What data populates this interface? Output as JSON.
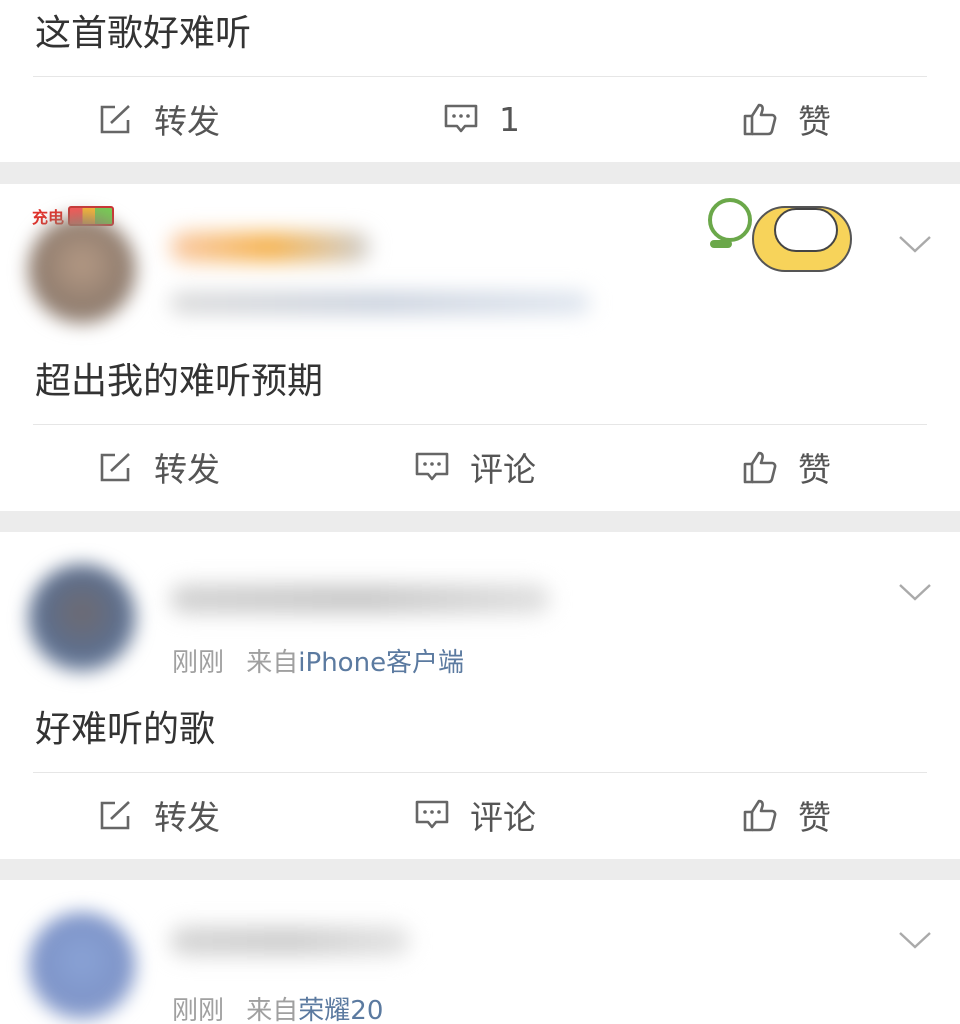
{
  "posts": [
    {
      "text": "这首歌好难听",
      "actions": {
        "repost": "转发",
        "comment": "1",
        "like": "赞"
      }
    },
    {
      "badge": "充电",
      "text": "超出我的难听预期",
      "actions": {
        "repost": "转发",
        "comment": "评论",
        "like": "赞"
      }
    },
    {
      "time": "刚刚",
      "source_prefix": "来自",
      "source": "iPhone客户端",
      "text": "好难听的歌",
      "actions": {
        "repost": "转发",
        "comment": "评论",
        "like": "赞"
      }
    },
    {
      "time": "刚刚",
      "source_prefix": "来自",
      "source": "荣耀20"
    }
  ],
  "icons": {
    "repost": "share-edit-icon",
    "comment": "comment-bubble-icon",
    "like": "thumbs-up-icon",
    "more": "chevron-down-icon"
  },
  "colors": {
    "background": "#ececec",
    "card": "#ffffff",
    "link": "#5b7aa0",
    "meta": "#a0a0a0"
  }
}
